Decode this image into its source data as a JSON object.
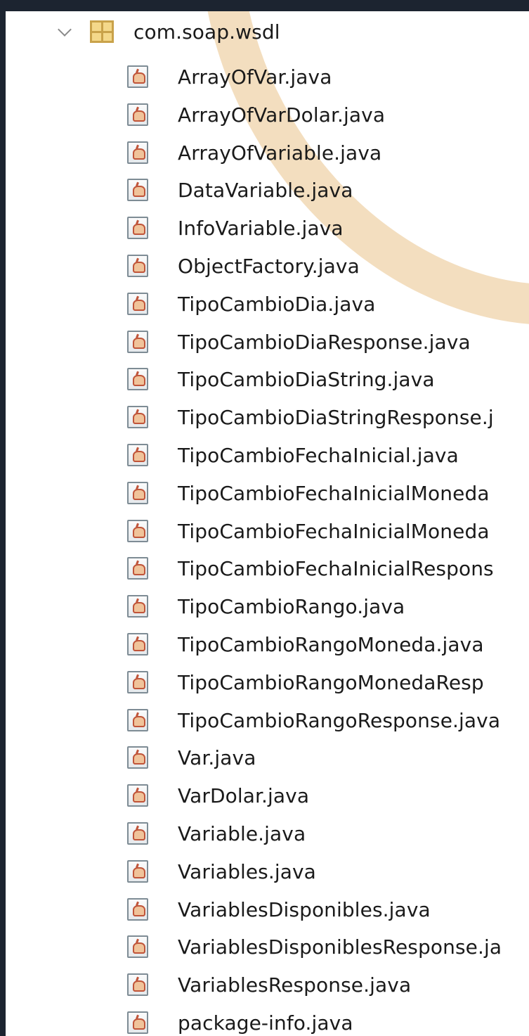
{
  "package": {
    "name": "com.soap.wsdl",
    "icon": "package-icon",
    "expand_icon": "chevron-down-icon"
  },
  "files": [
    {
      "name": "ArrayOfVar.java"
    },
    {
      "name": "ArrayOfVarDolar.java"
    },
    {
      "name": "ArrayOfVariable.java"
    },
    {
      "name": "DataVariable.java"
    },
    {
      "name": "InfoVariable.java"
    },
    {
      "name": "ObjectFactory.java"
    },
    {
      "name": "TipoCambioDia.java"
    },
    {
      "name": "TipoCambioDiaResponse.java"
    },
    {
      "name": "TipoCambioDiaString.java"
    },
    {
      "name": "TipoCambioDiaStringResponse.j"
    },
    {
      "name": "TipoCambioFechaInicial.java"
    },
    {
      "name": "TipoCambioFechaInicialMoneda"
    },
    {
      "name": "TipoCambioFechaInicialMoneda"
    },
    {
      "name": "TipoCambioFechaInicialRespons"
    },
    {
      "name": "TipoCambioRango.java"
    },
    {
      "name": "TipoCambioRangoMoneda.java"
    },
    {
      "name": "TipoCambioRangoMonedaResp"
    },
    {
      "name": "TipoCambioRangoResponse.java"
    },
    {
      "name": "Var.java"
    },
    {
      "name": "VarDolar.java"
    },
    {
      "name": "Variable.java"
    },
    {
      "name": "Variables.java"
    },
    {
      "name": "VariablesDisponibles.java"
    },
    {
      "name": "VariablesDisponiblesResponse.ja"
    },
    {
      "name": "VariablesResponse.java"
    },
    {
      "name": "package-info.java"
    }
  ],
  "file_icon": "java-file-icon",
  "next_item": {
    "name": "",
    "icon": "folder-icon",
    "expand_icon": "chevron-right-icon"
  }
}
